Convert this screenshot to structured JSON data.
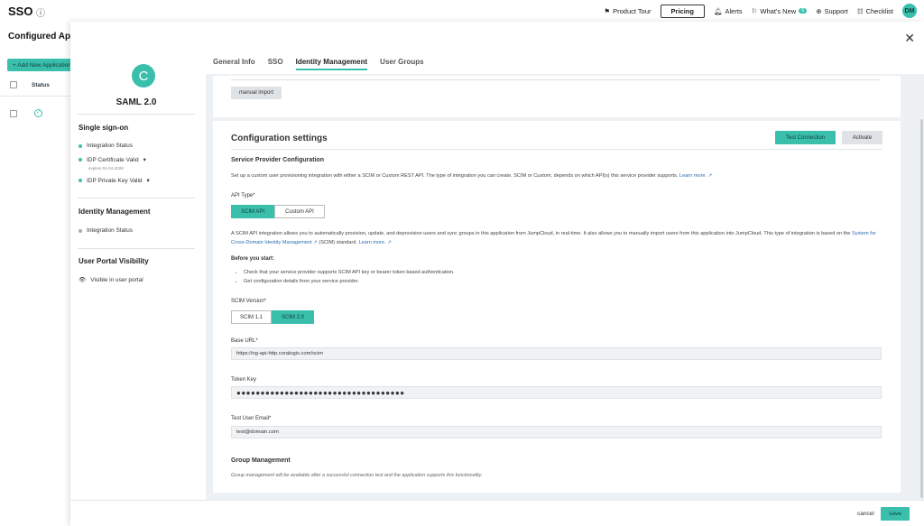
{
  "topbar": {
    "title": "SSO",
    "info_icon": "info-icon",
    "nav": {
      "product_tour": "Product Tour",
      "pricing": "Pricing",
      "alerts": "Alerts",
      "whats_new": "What's New",
      "whats_new_count": "6",
      "support": "Support",
      "checklist": "Checklist",
      "avatar": "DM"
    }
  },
  "background": {
    "title": "Configured Apps",
    "add_button": "+ Add New Application",
    "status_header": "Status"
  },
  "sidebar": {
    "logo_letter": "C",
    "app_name": "SAML 2.0",
    "single_signon": {
      "title": "Single sign-on",
      "items": [
        "Integration Status",
        "IDP Certificate Valid",
        "IDP Private Key Valid"
      ],
      "cert_note": "expires 01-04-2028"
    },
    "identity_management": {
      "title": "Identity Management",
      "items": [
        "Integration Status"
      ]
    },
    "user_portal": {
      "title": "User Portal Visibility",
      "visible": "Visible in user portal"
    }
  },
  "tabs": [
    {
      "label": "General Info",
      "active": false
    },
    {
      "label": "SSO",
      "active": false
    },
    {
      "label": "Identity Management",
      "active": true
    },
    {
      "label": "User Groups",
      "active": false
    }
  ],
  "import_card": {
    "manual_import": "manual import"
  },
  "config": {
    "title": "Configuration settings",
    "test_connection": "Test Connection",
    "activate": "Activate",
    "sp_title": "Service Provider Configuration",
    "sp_desc": "Set up a custom user provisioning integration with either a SCIM or Custom REST API. The type of integration you can create, SCIM or Custom, depends on which API(s) this service provider supports.",
    "learn_more": "Learn more. ↗",
    "api_type_label": "API Type*",
    "api_types": [
      "SCIM API",
      "Custom API"
    ],
    "api_type_selected": "SCIM API",
    "scim_desc_1": "A SCIM API integration allows you to automatically provision, update, and deprovision users and sync groups in this application from JumpCloud, in real-time. It also allows you to manually import users from this application into JumpCloud. This type of integration is based on the",
    "scim_link": "System for Cross-Domain Identity Management ↗",
    "scim_desc_2": "(SCIM) standard.",
    "learn_more_2": "Learn more. ↗",
    "before_start": "Before you start:",
    "bullets": [
      "Check that your service provider supports SCIM API key or bearer token based authenitcation.",
      "Get configuration details from your service provider."
    ],
    "scim_version_label": "SCIM Version*",
    "scim_versions": [
      "SCIM 1.1",
      "SCIM 2.0"
    ],
    "scim_version_selected": "SCIM 2.0",
    "base_url_label": "Base URL*",
    "base_url": "https://ng-api-http.coralogix.com/scim",
    "token_label": "Token Key",
    "token_value": "●●●●●●●●●●●●●●●●●●●●●●●●●●●●●●●●●●●",
    "test_email_label": "Test User Email*",
    "test_email": "test@domain.com",
    "group_title": "Group Management",
    "group_note": "Group management will be available after a successful connection test and the application supports this functionality."
  },
  "footer": {
    "cancel": "cancel",
    "save": "save"
  },
  "colors": {
    "accent": "#3bbfad",
    "link": "#2b6cb0"
  }
}
